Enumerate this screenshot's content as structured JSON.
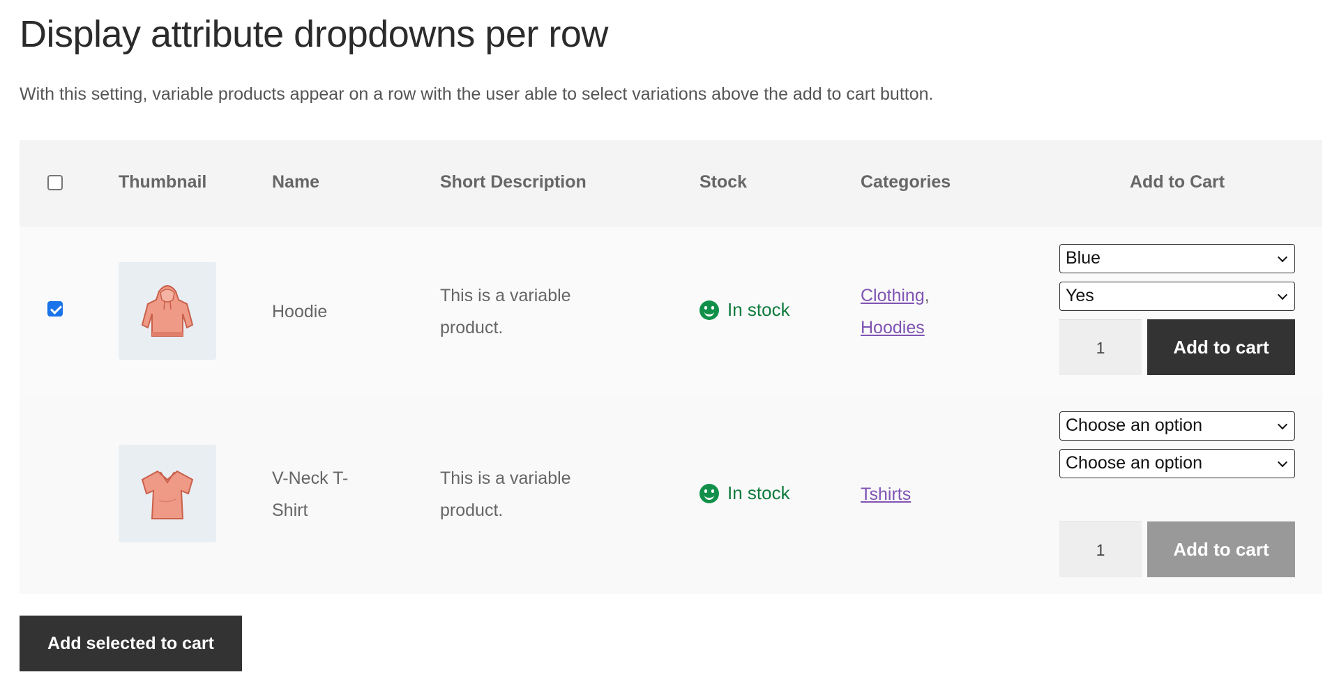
{
  "page": {
    "title": "Display attribute dropdowns per row",
    "intro": "With this setting, variable products appear on a row with the user able to select variations above the add to cart button."
  },
  "table": {
    "headers": {
      "thumbnail": "Thumbnail",
      "name": "Name",
      "short_description": "Short Description",
      "stock": "Stock",
      "categories": "Categories",
      "add_to_cart": "Add to Cart"
    },
    "select_all_checked": false,
    "rows": [
      {
        "checked": true,
        "thumbnail_icon": "hoodie-image",
        "name": "Hoodie",
        "desc_line1": "This is a variable",
        "desc_line2": "product.",
        "stock": "In stock",
        "category_1": "Clothing",
        "category_sep": ",",
        "category_2": "Hoodies",
        "select_1": "Blue",
        "select_2": "Yes",
        "qty": "1",
        "add_label": "Add to cart",
        "add_enabled": true
      },
      {
        "checked": false,
        "thumbnail_icon": "tshirt-image",
        "name_line1": "V-Neck T-",
        "name_line2": "Shirt",
        "desc_line1": "This is a variable",
        "desc_line2": "product.",
        "stock": "In stock",
        "category_1": "Tshirts",
        "select_1": "Choose an option",
        "select_2": "Choose an option",
        "qty": "1",
        "add_label": "Add to cart",
        "add_enabled": false
      }
    ]
  },
  "bulk_button": "Add selected to cart",
  "colors": {
    "accent_link": "#7f54b3",
    "stock_green": "#0f7a3c",
    "button_dark": "#333333",
    "button_disabled": "#999999",
    "checkbox_blue": "#1a73e8"
  }
}
